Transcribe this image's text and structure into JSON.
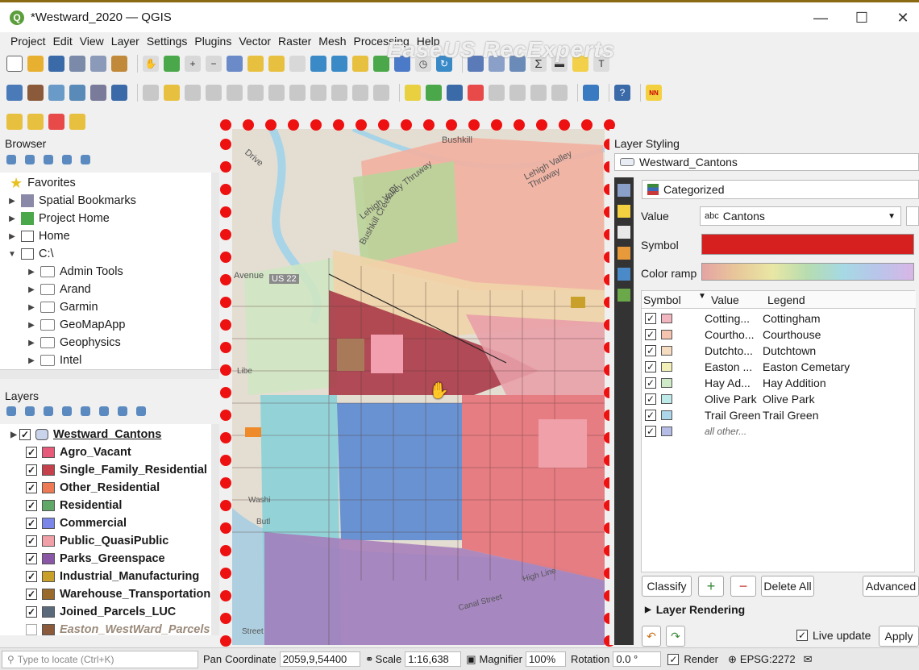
{
  "window": {
    "title": "*Westward_2020 — QGIS",
    "minimize": "—",
    "maximize": "☐",
    "close": "✕"
  },
  "menu": [
    "Project",
    "Edit",
    "View",
    "Layer",
    "Settings",
    "Plugins",
    "Vector",
    "Raster",
    "Mesh",
    "Processing",
    "Help"
  ],
  "watermark": "EaseUS RecExperts",
  "browser": {
    "title": "Browser",
    "items": [
      {
        "label": "Favorites",
        "icon": "star-icon"
      },
      {
        "label": "Spatial Bookmarks",
        "icon": "bookmark-icon"
      },
      {
        "label": "Project Home",
        "icon": "project-home-icon"
      },
      {
        "label": "Home",
        "icon": "home-icon"
      },
      {
        "label": "C:\\",
        "icon": "drive-icon"
      },
      {
        "label": "Admin Tools",
        "icon": "folder-icon"
      },
      {
        "label": "Arand",
        "icon": "folder-icon"
      },
      {
        "label": "Garmin",
        "icon": "folder-icon"
      },
      {
        "label": "GeoMapApp",
        "icon": "folder-icon"
      },
      {
        "label": "Geophysics",
        "icon": "folder-icon"
      },
      {
        "label": "Intel",
        "icon": "folder-icon"
      }
    ]
  },
  "layers": {
    "title": "Layers",
    "items": [
      {
        "label": "Westward_Cantons",
        "color": "#c9d3ea"
      },
      {
        "label": "Agro_Vacant",
        "color": "#e85a7a"
      },
      {
        "label": "Single_Family_Residential",
        "color": "#c4404a"
      },
      {
        "label": "Other_Residential",
        "color": "#ee7a55"
      },
      {
        "label": "Residential",
        "color": "#5fa868"
      },
      {
        "label": "Commercial",
        "color": "#7a86e8"
      },
      {
        "label": "Public_QuasiPublic",
        "color": "#f2a0a8"
      },
      {
        "label": "Parks_Greenspace",
        "color": "#8a56a6"
      },
      {
        "label": "Industrial_Manufacturing",
        "color": "#c9a02a"
      },
      {
        "label": "Warehouse_Transportation",
        "color": "#9a6a2a"
      },
      {
        "label": "Joined_Parcels_LUC",
        "color": "#5a6a7a"
      },
      {
        "label": "Easton_WestWard_Parcels",
        "color": "#8a5a3a"
      }
    ]
  },
  "styling": {
    "title": "Layer Styling",
    "layer": "Westward_Cantons",
    "renderer": "Categorized",
    "value_label": "Value",
    "value": "Cantons",
    "value_prefix": "abc",
    "symbol_label": "Symbol",
    "symbol_color": "#d61f1f",
    "ramp_label": "Color ramp",
    "columns": [
      "Symbol",
      "Value",
      "Legend"
    ],
    "categories": [
      {
        "value": "Cotting...",
        "legend": "Cottingham",
        "color": "#f2b6c0"
      },
      {
        "value": "Courtho...",
        "legend": "Courthouse",
        "color": "#f5c4b0"
      },
      {
        "value": "Dutchto...",
        "legend": "Dutchtown",
        "color": "#f5dcc0"
      },
      {
        "value": "Easton ...",
        "legend": "Easton Cemetary",
        "color": "#f3efb8"
      },
      {
        "value": "Hay Ad...",
        "legend": "Hay Addition",
        "color": "#cfeac6"
      },
      {
        "value": "Olive Park",
        "legend": "Olive Park",
        "color": "#bdeae8"
      },
      {
        "value": "Trail Green",
        "legend": "Trail Green",
        "color": "#aed6ea"
      },
      {
        "value": "all other...",
        "legend": "",
        "color": "#b5bde6"
      }
    ],
    "buttons": {
      "classify": "Classify",
      "delete_all": "Delete All",
      "advanced": "Advanced"
    },
    "layer_rendering": "Layer Rendering",
    "live_update": "Live update",
    "apply": "Apply"
  },
  "map_labels": {
    "drive": "Drive",
    "throughway": "Lehigh Valley Thruway",
    "throughway2": "Lehigh Valley Thruway",
    "creek": "Bushkill Creek Dr",
    "us22": "US 22",
    "avenue": "Avenue",
    "canal": "Canal Street",
    "street": "Street",
    "wash": "Washi",
    "lib": "Libe",
    "butl": "Butl",
    "high": "High Line",
    "bushkill": "Bushkill"
  },
  "status": {
    "locate_placeholder": "Type to locate (Ctrl+K)",
    "pan": "Pan",
    "coordinate_label": "Coordinate",
    "coordinate": "2059,9,54400",
    "scale_label": "Scale",
    "scale": "1:16,638",
    "magnifier_label": "Magnifier",
    "magnifier": "100%",
    "rotation_label": "Rotation",
    "rotation": "0.0 °",
    "render": "Render",
    "crs": "EPSG:2272"
  }
}
